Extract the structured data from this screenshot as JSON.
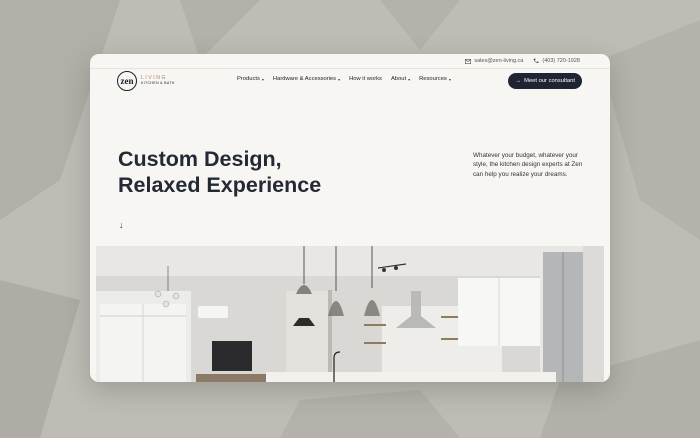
{
  "topbar": {
    "email": "sales@zen-living.ca",
    "phone": "(403) 720-1928",
    "email_icon": "mail-icon",
    "phone_icon": "phone-icon"
  },
  "logo": {
    "mark": "zen",
    "line1": "LIVING",
    "line2": "KITCHEN & BATH"
  },
  "nav": [
    {
      "label": "Products",
      "caret": "▾"
    },
    {
      "label": "Hardware & Accessories",
      "caret": "▾"
    },
    {
      "label": "How it works",
      "caret": ""
    },
    {
      "label": "About",
      "caret": "▾"
    },
    {
      "label": "Resources",
      "caret": "▾"
    }
  ],
  "cta": {
    "label": "Meet our consultant",
    "arrow": "→"
  },
  "hero": {
    "title_line1": "Custom Design,",
    "title_line2": "Relaxed Experience",
    "description": "Whatever your budget, whatever your style, the kitchen design experts at Zen can help you realize your dreams.",
    "scroll_arrow": "↓"
  },
  "colors": {
    "primary_dark": "#1f2433",
    "page_bg": "#f7f6f3",
    "outer_bg": "#bdbbb3",
    "logo_accent": "#b07a5a"
  }
}
